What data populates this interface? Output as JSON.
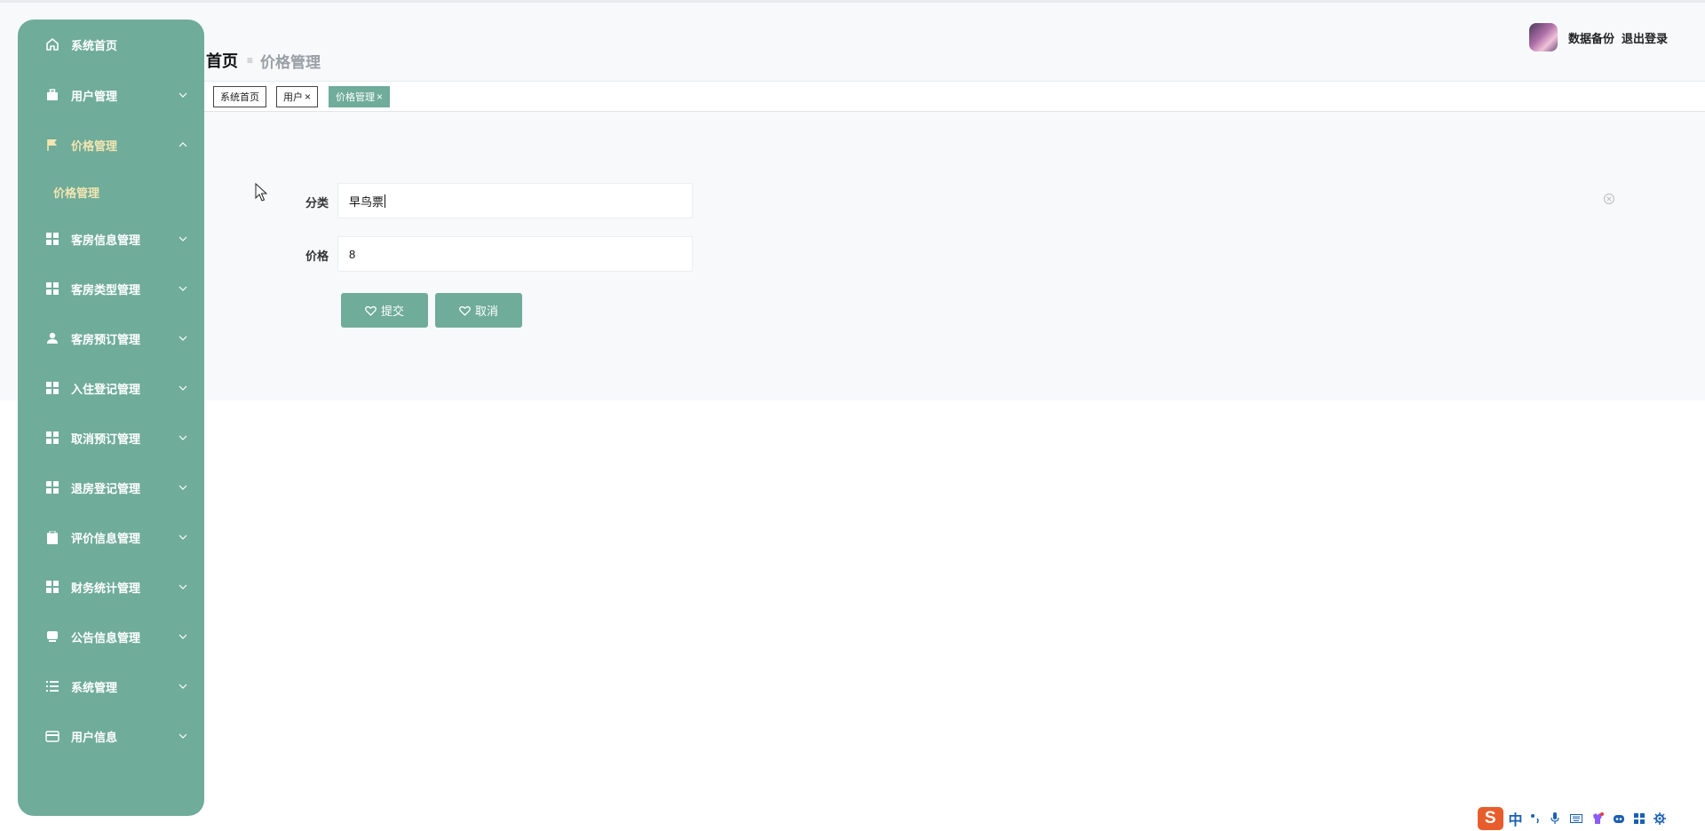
{
  "colors": {
    "accent": "#6fac99",
    "active_menu_text": "#f3e5b2",
    "content_bg": "#f7f9fb"
  },
  "sidebar": {
    "items": [
      {
        "label": "系统首页",
        "icon": "home-icon",
        "has_arrow": false
      },
      {
        "label": "用户管理",
        "icon": "briefcase-icon",
        "has_arrow": true
      },
      {
        "label": "价格管理",
        "icon": "flag-icon",
        "has_arrow": true,
        "expanded": true
      },
      {
        "label": "客房信息管理",
        "icon": "grid-icon",
        "has_arrow": true
      },
      {
        "label": "客房类型管理",
        "icon": "grid-icon",
        "has_arrow": true
      },
      {
        "label": "客房预订管理",
        "icon": "person-icon",
        "has_arrow": true
      },
      {
        "label": "入住登记管理",
        "icon": "grid-icon",
        "has_arrow": true
      },
      {
        "label": "取消预订管理",
        "icon": "grid-icon",
        "has_arrow": true
      },
      {
        "label": "退房登记管理",
        "icon": "grid-icon",
        "has_arrow": true
      },
      {
        "label": "评价信息管理",
        "icon": "clipboard-icon",
        "has_arrow": true
      },
      {
        "label": "财务统计管理",
        "icon": "grid-icon",
        "has_arrow": true
      },
      {
        "label": "公告信息管理",
        "icon": "monitor-icon",
        "has_arrow": true
      },
      {
        "label": "系统管理",
        "icon": "list-icon",
        "has_arrow": true
      },
      {
        "label": "用户信息",
        "icon": "card-icon",
        "has_arrow": true
      }
    ],
    "submenu": {
      "label": "价格管理"
    }
  },
  "breadcrumb": {
    "home": "首页",
    "separator": "≡",
    "current": "价格管理"
  },
  "user": {
    "backup": "数据备份",
    "logout": "退出登录"
  },
  "tags": [
    {
      "label": "系统首页",
      "closable": false,
      "active": false
    },
    {
      "label": "用户",
      "closable": true,
      "active": false
    },
    {
      "label": "价格管理",
      "closable": true,
      "active": true
    }
  ],
  "tag_close": "×",
  "form": {
    "category_label": "分类",
    "category_value": "早鸟票",
    "price_label": "价格",
    "price_value": "8",
    "submit_label": "提交",
    "cancel_label": "取消"
  },
  "ime": {
    "logo": "S",
    "mode": "中"
  }
}
